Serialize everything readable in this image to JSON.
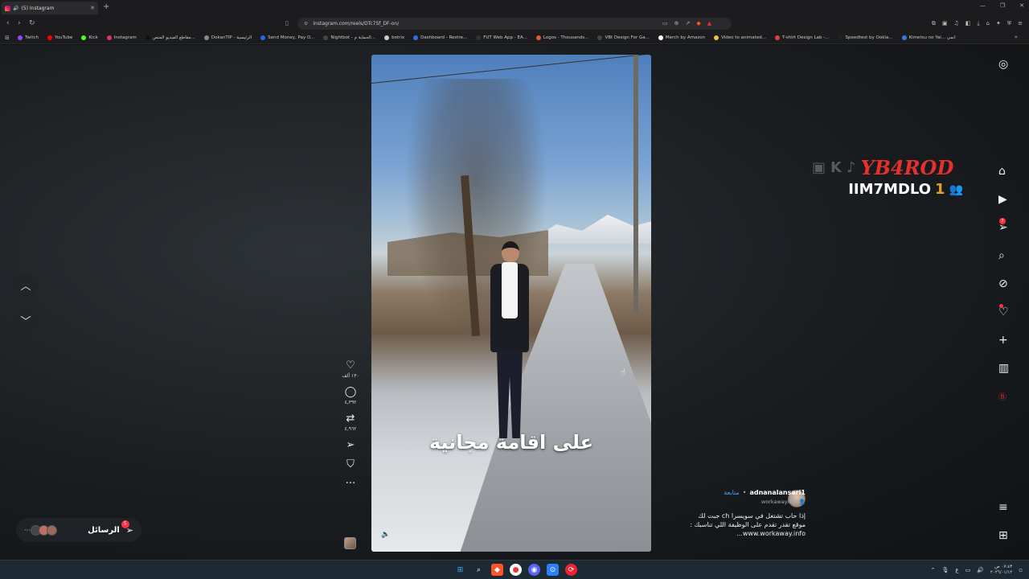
{
  "browser": {
    "tab_title": "(5) Instagram",
    "url": "instagram.com/reels/DTc7Sf_DF-on/",
    "bookmarks": [
      {
        "label": "Twitch",
        "color": "#9146ff"
      },
      {
        "label": "YouTube",
        "color": "#ff0000"
      },
      {
        "label": "Kick",
        "color": "#53fc18"
      },
      {
        "label": "Instagram",
        "color": "#e1306c"
      },
      {
        "label": "مقاطع الفيديو المنص...",
        "color": "#111111"
      },
      {
        "label": "DokanTIP - الرئيسية",
        "color": "#888888"
      },
      {
        "label": "Send Money, Pay O...",
        "color": "#1e6ce8"
      },
      {
        "label": "Nightbot - الحماية م...",
        "color": "#444444"
      },
      {
        "label": "botrix",
        "color": "#cccccc"
      },
      {
        "label": "Dashboard - Restre...",
        "color": "#2f6fed"
      },
      {
        "label": "FUT Web App - EA...",
        "color": "#333333"
      },
      {
        "label": "Logos - Thousands...",
        "color": "#e0583a"
      },
      {
        "label": "VBt Design For Ga...",
        "color": "#444444"
      },
      {
        "label": "Merch by Amazon",
        "color": "#ffffff"
      },
      {
        "label": "Video to animated...",
        "color": "#f0c040"
      },
      {
        "label": "T-shirt Design Lab -...",
        "color": "#e04040"
      },
      {
        "label": "Speedtest by Ookla...",
        "color": "#222222"
      },
      {
        "label": "Kimetsu no Yai... انمي",
        "color": "#3a7bd5"
      }
    ]
  },
  "reel": {
    "caption": "على اقامة مجانية",
    "likes": "١٣٠ ألف",
    "comments": "٤,٣٩٢",
    "reposts": "٤,٩٦٢",
    "author": "adnanalansari1",
    "follow_label": "متابعة",
    "sub_label": "workawayinfo",
    "description_line1": "إذا حاب تشتغل في سويسرا ch جبت لك",
    "description_line2": "موقع تقدر تقدم على الوظيفة اللي تناسبك :",
    "description_line3": "www.workaway.info..."
  },
  "overlay": {
    "brand_name": "YB4ROD",
    "sub_name": "IIM7MDLO",
    "sub_number": "1"
  },
  "messages": {
    "label": "الرسائل",
    "badge": "5"
  },
  "rightnav": {
    "notification_badge": "7"
  },
  "taskbar": {
    "time": "٠٧:٤٣ ص",
    "date": "٢٠٢٦/٠١/١٢",
    "lang": "ع"
  }
}
